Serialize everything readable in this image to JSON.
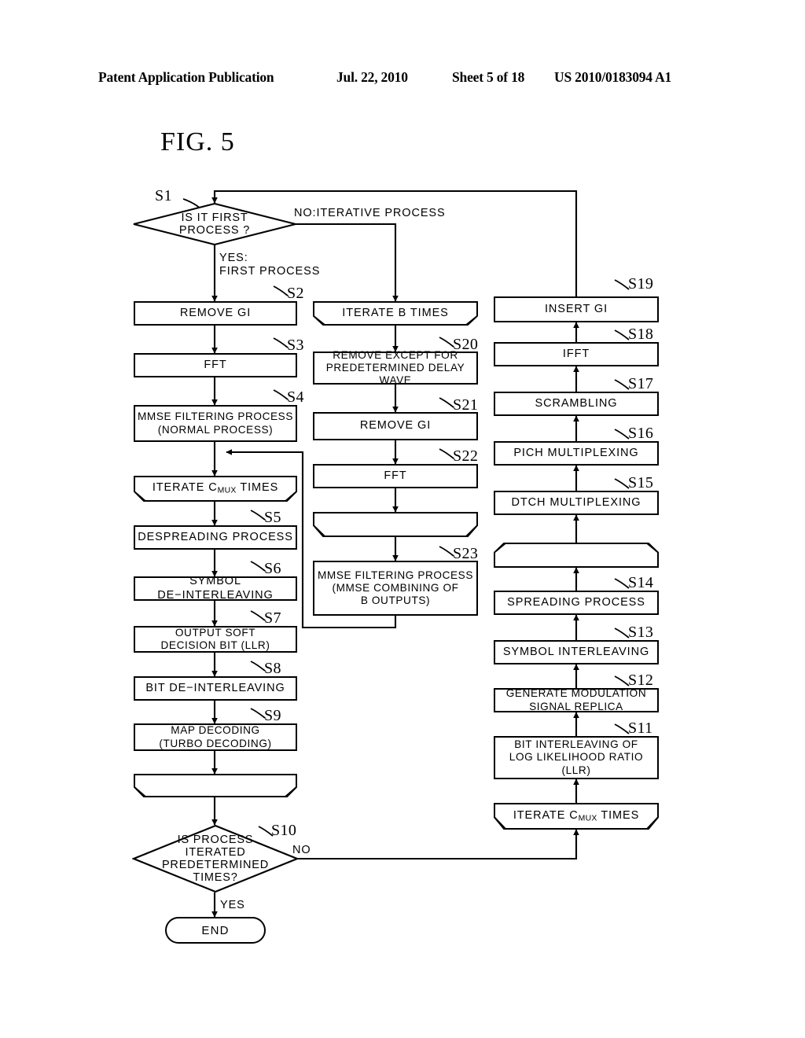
{
  "header": {
    "publication": "Patent Application Publication",
    "date": "Jul. 22, 2010",
    "sheet": "Sheet 5 of 18",
    "number": "US 2010/0183094 A1"
  },
  "figure": {
    "title": "FIG.  5",
    "type": "flowchart"
  },
  "nodes": {
    "s1": {
      "id": "S1",
      "text": "IS IT FIRST\nPROCESS ?",
      "shape": "decision"
    },
    "s2": {
      "id": "S2",
      "text": "REMOVE GI",
      "shape": "process"
    },
    "s3": {
      "id": "S3",
      "text": "FFT",
      "shape": "process"
    },
    "s4": {
      "id": "S4",
      "text": "MMSE FILTERING PROCESS\n(NORMAL PROCESS)",
      "shape": "process"
    },
    "loop_left_start": {
      "id": "",
      "text": "ITERATE C TIMES",
      "text_pre": "ITERATE C",
      "text_sub": "MUX",
      "text_post": " TIMES",
      "shape": "loop-start"
    },
    "s5": {
      "id": "S5",
      "text": "DESPREADING PROCESS",
      "shape": "process"
    },
    "s6": {
      "id": "S6",
      "text": "SYMBOL DE−INTERLEAVING",
      "shape": "process"
    },
    "s7": {
      "id": "S7",
      "text": "OUTPUT SOFT\nDECISION BIT (LLR)",
      "shape": "process"
    },
    "s8": {
      "id": "S8",
      "text": "BIT DE−INTERLEAVING",
      "shape": "process"
    },
    "s9": {
      "id": "S9",
      "text": "MAP DECODING\n(TURBO DECODING)",
      "shape": "process"
    },
    "loop_left_end": {
      "id": "",
      "text": "",
      "shape": "loop-end"
    },
    "s10": {
      "id": "S10",
      "text": "IS PROCESS\nITERATED\nPREDETERMINED\nTIMES?",
      "shape": "decision"
    },
    "end": {
      "id": "",
      "text": "END",
      "shape": "terminator"
    },
    "loop_mid_start": {
      "id": "",
      "text": "ITERATE B TIMES",
      "shape": "loop-start"
    },
    "s20": {
      "id": "S20",
      "text": "REMOVE EXCEPT FOR\nPREDETERMINED DELAY WAVE",
      "shape": "process"
    },
    "s21": {
      "id": "S21",
      "text": "REMOVE GI",
      "shape": "process"
    },
    "s22": {
      "id": "S22",
      "text": "FFT",
      "shape": "process"
    },
    "loop_mid_end": {
      "id": "",
      "text": "",
      "shape": "loop-end"
    },
    "s23": {
      "id": "S23",
      "text": "MMSE FILTERING PROCESS\n(MMSE COMBINING OF\nB OUTPUTS)",
      "shape": "process"
    },
    "s19": {
      "id": "S19",
      "text": "INSERT GI",
      "shape": "process"
    },
    "s18": {
      "id": "S18",
      "text": "IFFT",
      "shape": "process"
    },
    "s17": {
      "id": "S17",
      "text": "SCRAMBLING",
      "shape": "process"
    },
    "s16": {
      "id": "S16",
      "text": "PICH MULTIPLEXING",
      "shape": "process"
    },
    "s15": {
      "id": "S15",
      "text": "DTCH MULTIPLEXING",
      "shape": "process"
    },
    "loop_right_end": {
      "id": "",
      "text": "",
      "shape": "loop-end"
    },
    "s14": {
      "id": "S14",
      "text": "SPREADING PROCESS",
      "shape": "process"
    },
    "s13": {
      "id": "S13",
      "text": "SYMBOL INTERLEAVING",
      "shape": "process"
    },
    "s12": {
      "id": "S12",
      "text": "GENERATE MODULATION\nSIGNAL REPLICA",
      "shape": "process"
    },
    "s11": {
      "id": "S11",
      "text": "BIT INTERLEAVING OF\nLOG LIKELIHOOD RATIO\n(LLR)",
      "shape": "process"
    },
    "loop_right_start": {
      "id": "",
      "text_pre": "ITERATE C",
      "text_sub": "MUX",
      "text_post": " TIMES",
      "shape": "loop-start"
    }
  },
  "edge_labels": {
    "s1_no": "NO:ITERATIVE PROCESS",
    "s1_yes": "YES:\nFIRST PROCESS",
    "s10_no": "NO",
    "s10_yes": "YES"
  },
  "step_labels": {
    "s1": "S1",
    "s2": "S2",
    "s3": "S3",
    "s4": "S4",
    "s5": "S5",
    "s6": "S6",
    "s7": "S7",
    "s8": "S8",
    "s9": "S9",
    "s10": "S10",
    "s11": "S11",
    "s12": "S12",
    "s13": "S13",
    "s14": "S14",
    "s15": "S15",
    "s16": "S16",
    "s17": "S17",
    "s18": "S18",
    "s19": "S19",
    "s20": "S20",
    "s21": "S21",
    "s22": "S22",
    "s23": "S23"
  },
  "colors": {
    "ink": "#000000",
    "paper": "#ffffff"
  }
}
